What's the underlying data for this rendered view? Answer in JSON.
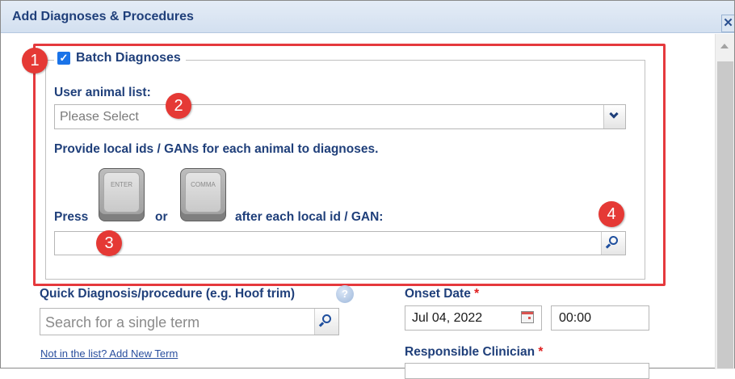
{
  "dialog": {
    "title": "Add Diagnoses & Procedures",
    "close_glyph": "✕"
  },
  "batch": {
    "checkbox_checked": true,
    "checkbox_glyph": "✓",
    "legend": "Batch Diagnoses",
    "animal_list_label": "User animal list:",
    "animal_list_value": "Please Select",
    "instruction": "Provide local ids / GANs for each animal to diagnoses.",
    "press_label": "Press",
    "or_label": "or",
    "after_label": "after each local id / GAN:",
    "enter_key": "ENTER",
    "comma_key": "COMMA",
    "gan_input_value": ""
  },
  "callouts": [
    "1",
    "2",
    "3",
    "4"
  ],
  "quick": {
    "label": "Quick Diagnosis/procedure (e.g. Hoof trim)",
    "help_glyph": "?",
    "search_placeholder": "Search for a single term",
    "add_new_link": "Not in the list? Add New Term"
  },
  "onset": {
    "label": "Onset Date",
    "required_mark": "*",
    "date_value": "Jul 04, 2022",
    "time_value": "00:00"
  },
  "clinician": {
    "label": "Responsible Clinician",
    "required_mark": "*"
  },
  "colors": {
    "highlight": "#e5393d",
    "label_blue": "#1f3f7a",
    "checkbox": "#1a73e8"
  }
}
